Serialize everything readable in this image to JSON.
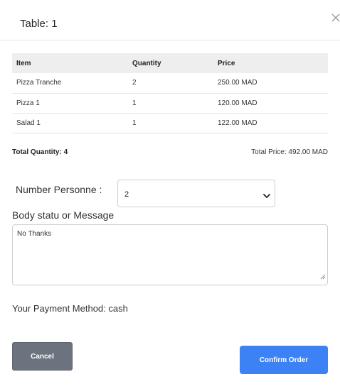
{
  "modal": {
    "title": "Table: 1",
    "close_icon": "close-icon"
  },
  "table": {
    "headers": [
      "Item",
      "Quantity",
      "Price"
    ],
    "rows": [
      [
        "Pizza Tranche",
        "2",
        "250.00 MAD"
      ],
      [
        "Pizza 1",
        "1",
        "120.00 MAD"
      ],
      [
        "Salad 1",
        "1",
        "122.00 MAD"
      ]
    ]
  },
  "totals": {
    "quantity": "Total Quantity: 4",
    "price": "Total Price: 492.00 MAD"
  },
  "persons": {
    "label": "Number Personne :",
    "selected": "2",
    "icon": "chevron-down-icon"
  },
  "message": {
    "label": "Body statu or Message",
    "value": "No Thanks"
  },
  "payment": {
    "text": "Your Payment Method: cash"
  },
  "actions": {
    "cancel_label": "Cancel",
    "confirm_label": "Confirm Order"
  },
  "colors": {
    "cancel_button": "#6c737e",
    "confirm_button": "#3d82f4",
    "table_header_bg": "#eeeeee"
  }
}
